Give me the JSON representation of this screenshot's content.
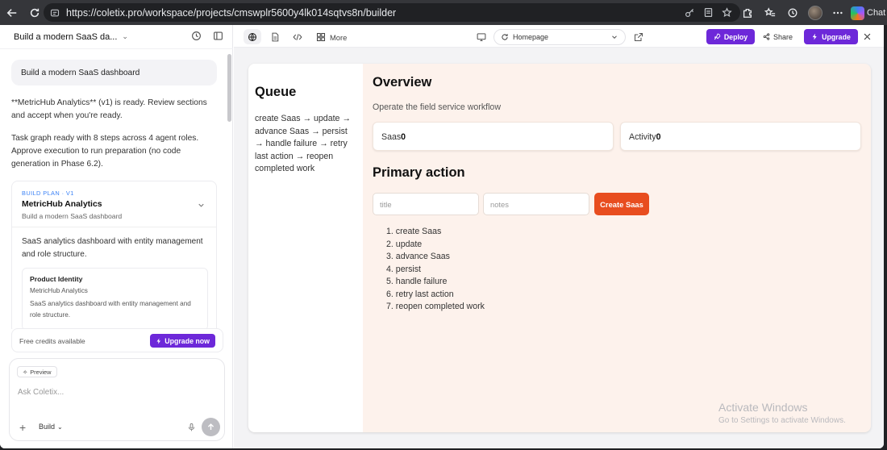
{
  "browser": {
    "url": "https://coletix.pro/workspace/projects/cmswplr5600y4lk014sqtvs8n/builder",
    "chat_label": "Chat"
  },
  "left_panel": {
    "project_title": "Build a modern SaaS da...",
    "user_message": "Build a modern SaaS dashboard",
    "assistant_message_1": "**MetricHub Analytics** (v1) is ready. Review sections and accept when you're ready.",
    "assistant_message_2": "Task graph ready with 8 steps across 4 agent roles. Approve execution to run preparation (no code generation in Phase 6.2).",
    "plan_card": {
      "tag": "BUILD PLAN · V1",
      "name": "MetricHub Analytics",
      "subtitle": "Build a modern SaaS dashboard",
      "description": "SaaS analytics dashboard with entity management and role structure.",
      "identity": {
        "title": "Product Identity",
        "name": "MetricHub Analytics",
        "description": "SaaS analytics dashboard with entity management and role structure."
      }
    },
    "credits_text": "Free credits available",
    "upgrade_now_label": "Upgrade now",
    "composer": {
      "preview_chip": "Preview",
      "placeholder": "Ask Coletix...",
      "mode_label": "Build"
    }
  },
  "toolbar": {
    "more_label": "More",
    "page_select_value": "Homepage",
    "deploy_label": "Deploy",
    "share_label": "Share",
    "upgrade_label": "Upgrade"
  },
  "preview": {
    "sidebar_title": "Queue",
    "queue_text": "create Saas → update → advance Saas → persist → handle failure → retry last action → reopen completed work",
    "overview_title": "Overview",
    "overview_subtitle": "Operate the field service workflow",
    "stats": [
      {
        "label": "Saas",
        "value": "0"
      },
      {
        "label": "Activity",
        "value": "0"
      }
    ],
    "primary_action_title": "Primary action",
    "title_placeholder": "title",
    "notes_placeholder": "notes",
    "create_button_label": "Create Saas",
    "steps": [
      "create Saas",
      "update",
      "advance Saas",
      "persist",
      "handle failure",
      "retry last action",
      "reopen completed work"
    ]
  },
  "watermark": {
    "title": "Activate Windows",
    "subtitle": "Go to Settings to activate Windows."
  }
}
